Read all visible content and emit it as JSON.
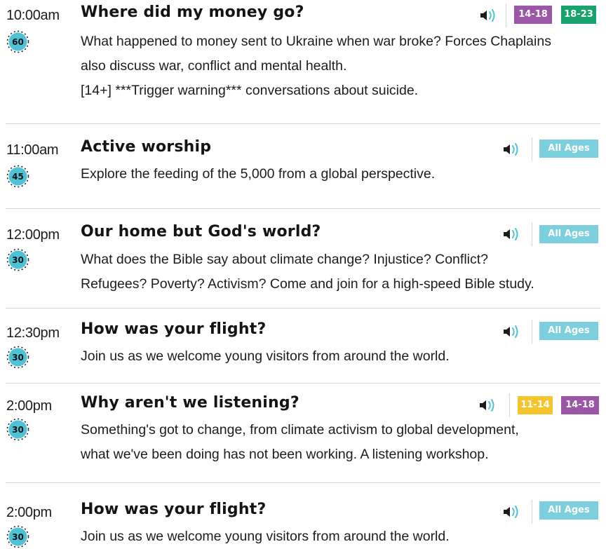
{
  "colors": {
    "all_ages": "#7ccfdc",
    "age_14_18": "#9c56a8",
    "age_18_23": "#18a36a",
    "age_11_14": "#f6c52b",
    "timer_fill": "#4ec3d6",
    "divider": "#d6d6d6"
  },
  "sessions": [
    {
      "time": "10:00am",
      "duration": "60",
      "title": "Where did my money go?",
      "description": [
        "What happened to money sent to Ukraine when war broke? Forces Chaplains",
        "also discuss war, conflict and mental health.",
        "[14+] ***Trigger warning*** conversations about suicide."
      ],
      "audio_icon": "speaker-icon",
      "badges": [
        "14-18",
        "18-23"
      ]
    },
    {
      "time": "11:00am",
      "duration": "45",
      "title": "Active worship",
      "description": [
        "Explore the feeding of the 5,000 from a global perspective."
      ],
      "audio_icon": "speaker-icon",
      "badges": [
        "All Ages"
      ]
    },
    {
      "time": "12:00pm",
      "duration": "30",
      "title": "Our home but God's world?",
      "description": [
        "What does the Bible say about climate change? Injustice? Conflict?",
        "Refugees? Poverty? Activism?  Come and join for a high-speed Bible study."
      ],
      "audio_icon": "speaker-icon",
      "badges": [
        "All Ages"
      ]
    },
    {
      "time": "12:30pm",
      "duration": "30",
      "title": "How was your flight?",
      "description": [
        "Join us as we welcome young visitors from around the world."
      ],
      "audio_icon": "speaker-icon",
      "badges": [
        "All Ages"
      ]
    },
    {
      "time": "2:00pm",
      "duration": "30",
      "title": "Why aren't we listening?",
      "description": [
        "Something's got to change, from climate activism to global development,",
        "what we've been doing has not been working. A listening workshop."
      ],
      "audio_icon": "speaker-icon",
      "badges": [
        "11-14",
        "14-18"
      ]
    },
    {
      "time": "2:00pm",
      "duration": "30",
      "title": "How was your flight?",
      "description": [
        "Join us as we welcome young visitors from around the world."
      ],
      "audio_icon": "speaker-icon",
      "badges": [
        "All Ages"
      ]
    }
  ]
}
